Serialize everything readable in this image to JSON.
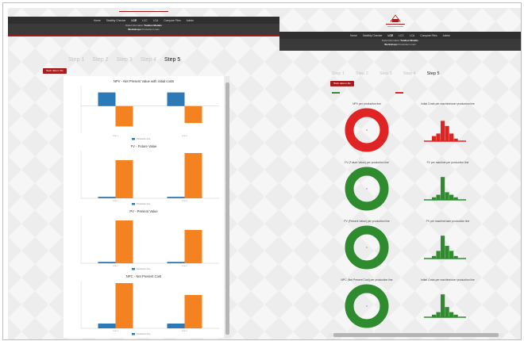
{
  "left_window": {
    "header_text": "",
    "nav_items": [
      "Home",
      "Stability Checker",
      "LCE",
      "LCC",
      "LCA",
      "Compare Files",
      "Admin"
    ],
    "nav_active": "LCE",
    "subnav": {
      "line1_label": "Data Information",
      "line1_value": "Toolbox Models",
      "line2_label": "Workshops",
      "line2_value": "Production Lines"
    },
    "steps": [
      "Step 1",
      "Step 2",
      "Step 3",
      "Step 4",
      "Step 5"
    ],
    "current_step": "Step 5",
    "back_button": "Back data to file",
    "legend_label": "Production line",
    "colors": {
      "blue": "#2c79b8",
      "orange": "#f58220",
      "nav": "#2f2f2f",
      "accent": "#a61d1d"
    }
  },
  "right_window": {
    "logo_text": "",
    "nav_items": [
      "Home",
      "Stability Checker",
      "LCE",
      "LCC",
      "LCA",
      "Compare Files",
      "Admin"
    ],
    "nav_active": "LCE",
    "subnav": {
      "line1_label": "Data Information",
      "line1_value": "Toolbox Models",
      "line2_label": "Workshops",
      "line2_value": "Production Lines"
    },
    "steps": [
      "Step 1",
      "Step 2",
      "Step 3",
      "Step 4",
      "Step 5"
    ],
    "current_step": "Step 5",
    "back_button": "Back data to file",
    "metrics": [
      {
        "left": "NPV per production line",
        "right": "Initial Costs per machine/user production line",
        "status": "bad"
      },
      {
        "left": "FV (Future Value) per production line",
        "right": "FV per machine per production line",
        "status": "good"
      },
      {
        "left": "PV (Present Value) per production line",
        "right": "PV per machine/user production line",
        "status": "good"
      },
      {
        "left": "NPC (Net Present Cost) per production line",
        "right": "Initial Costs per machine/user production line",
        "status": "good"
      }
    ],
    "colors": {
      "good": "#2e8b2e",
      "bad": "#e02424"
    }
  },
  "chart_data": [
    {
      "type": "bar",
      "title": "NPV - Net Present Value with initial costs",
      "categories": [
        "Line 1",
        "Line 2"
      ],
      "series": [
        {
          "color": "#2c79b8",
          "values": [
            2,
            2
          ]
        },
        {
          "color": "#f58220",
          "values": [
            -3,
            -2.5
          ]
        }
      ],
      "ylim": [
        -4,
        3
      ]
    },
    {
      "type": "bar",
      "title": "FV - Future Value",
      "categories": [
        "Line 1",
        "Line 2"
      ],
      "series": [
        {
          "color": "#2c79b8",
          "values": [
            0.3,
            0.3
          ]
        },
        {
          "color": "#f58220",
          "values": [
            8,
            9.5
          ]
        }
      ],
      "ylim": [
        0,
        10
      ]
    },
    {
      "type": "bar",
      "title": "PV - Present Value",
      "categories": [
        "Line 1",
        "Line 2"
      ],
      "series": [
        {
          "color": "#2c79b8",
          "values": [
            0.3,
            0.3
          ]
        },
        {
          "color": "#f58220",
          "values": [
            9,
            7
          ]
        }
      ],
      "ylim": [
        0,
        10
      ]
    },
    {
      "type": "bar",
      "title": "NPC - Net Present Cost",
      "categories": [
        "Line 1",
        "Line 2"
      ],
      "series": [
        {
          "color": "#2c79b8",
          "values": [
            1,
            1
          ]
        },
        {
          "color": "#f58220",
          "values": [
            9.5,
            7
          ]
        }
      ],
      "ylim": [
        0,
        10
      ]
    }
  ]
}
